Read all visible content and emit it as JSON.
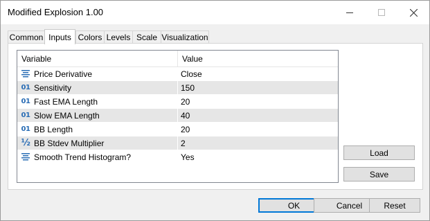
{
  "window": {
    "title": "Modified Explosion 1.00"
  },
  "tabs": [
    {
      "label": "Common"
    },
    {
      "label": "Inputs",
      "active": true
    },
    {
      "label": "Colors"
    },
    {
      "label": "Levels"
    },
    {
      "label": "Scale"
    },
    {
      "label": "Visualization"
    }
  ],
  "grid": {
    "headers": {
      "variable": "Variable",
      "value": "Value"
    },
    "rows": [
      {
        "icon": "list-icon",
        "variable": "Price Derivative",
        "value": "Close"
      },
      {
        "icon": "integer-icon",
        "variable": "Sensitivity",
        "value": "150"
      },
      {
        "icon": "integer-icon",
        "variable": "Fast EMA Length",
        "value": "20"
      },
      {
        "icon": "integer-icon",
        "variable": "Slow EMA Length",
        "value": "40"
      },
      {
        "icon": "integer-icon",
        "variable": "BB Length",
        "value": "20"
      },
      {
        "icon": "fraction-icon",
        "variable": "BB Stdev Multiplier",
        "value": "2"
      },
      {
        "icon": "list-icon",
        "variable": "Smooth Trend Histogram?",
        "value": "Yes"
      }
    ]
  },
  "side_buttons": {
    "load": "Load",
    "save": "Save"
  },
  "footer_buttons": {
    "ok": "OK",
    "cancel": "Cancel",
    "reset": "Reset"
  },
  "icon_glyphs": {
    "integer": "01",
    "fraction": "½"
  },
  "colors": {
    "accent": "#0078d7",
    "icon": "#2a6db5",
    "alt_row": "#e6e6e6"
  }
}
